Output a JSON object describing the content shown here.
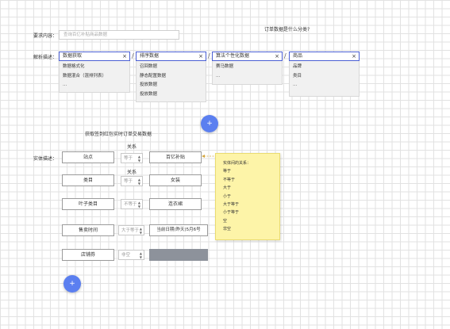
{
  "requirement": {
    "label": "要求内容：",
    "placeholder": "查询百亿补贴商品数据"
  },
  "question": "订单数据是什么分类?",
  "parse": {
    "label": "解析描述：",
    "slash": "/",
    "fields": [
      {
        "value": "数据获取",
        "clear": "×",
        "options": [
          "数据格式化",
          "数据混合（混排列表）",
          "..."
        ]
      },
      {
        "value": "排序数据",
        "clear": "×",
        "options": [
          "召回数据",
          "静态配置数据",
          "投放数据",
          "投放数据"
        ]
      },
      {
        "value": "算法个性化数据",
        "clear": "×",
        "options": [
          "赛马数据",
          "..."
        ]
      },
      {
        "value": "商品",
        "clear": "×",
        "options": [
          "品牌",
          "类目",
          "..."
        ]
      }
    ]
  },
  "add_button": "+",
  "entity": {
    "title": "获取签到红包实时订单交易数据",
    "label": "实体描述：",
    "relation_header": "关系",
    "arrow_down": "▲▼",
    "rows": [
      {
        "left": "站点",
        "op": "等于",
        "right": "百亿补贴"
      },
      {
        "left": "类目",
        "op": "等于",
        "right": "女装"
      },
      {
        "left": "叶子类目",
        "op": "不等于",
        "right": "连衣裙"
      },
      {
        "left": "售卖时间",
        "op": "大于等于",
        "right": "当前日期(昨天)5月6号"
      },
      {
        "left": "店铺券",
        "op": "非空",
        "right": ""
      }
    ]
  },
  "note": {
    "title": "实体间的关系：",
    "items": [
      "等于",
      "不等于",
      "大于",
      "小于",
      "大于等于",
      "小于等于",
      "空",
      "非空"
    ]
  },
  "colors": {
    "accent": "#5b7ff0",
    "note_bg": "#fdf4a8",
    "disabled_fill": "#8d929b"
  }
}
